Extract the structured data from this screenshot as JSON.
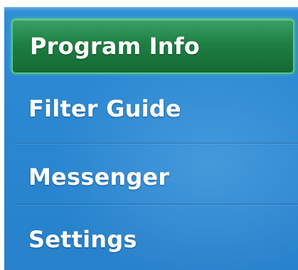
{
  "menu": {
    "items": [
      {
        "label": "Program Info",
        "selected": true
      },
      {
        "label": "Filter Guide",
        "selected": false
      },
      {
        "label": "Messenger",
        "selected": false
      },
      {
        "label": "Settings",
        "selected": false
      }
    ]
  },
  "colors": {
    "panel_background": "#2b88d2",
    "selected_background": "#1f7f42",
    "selected_border": "#5cc488",
    "label_text": "#ffffff"
  }
}
